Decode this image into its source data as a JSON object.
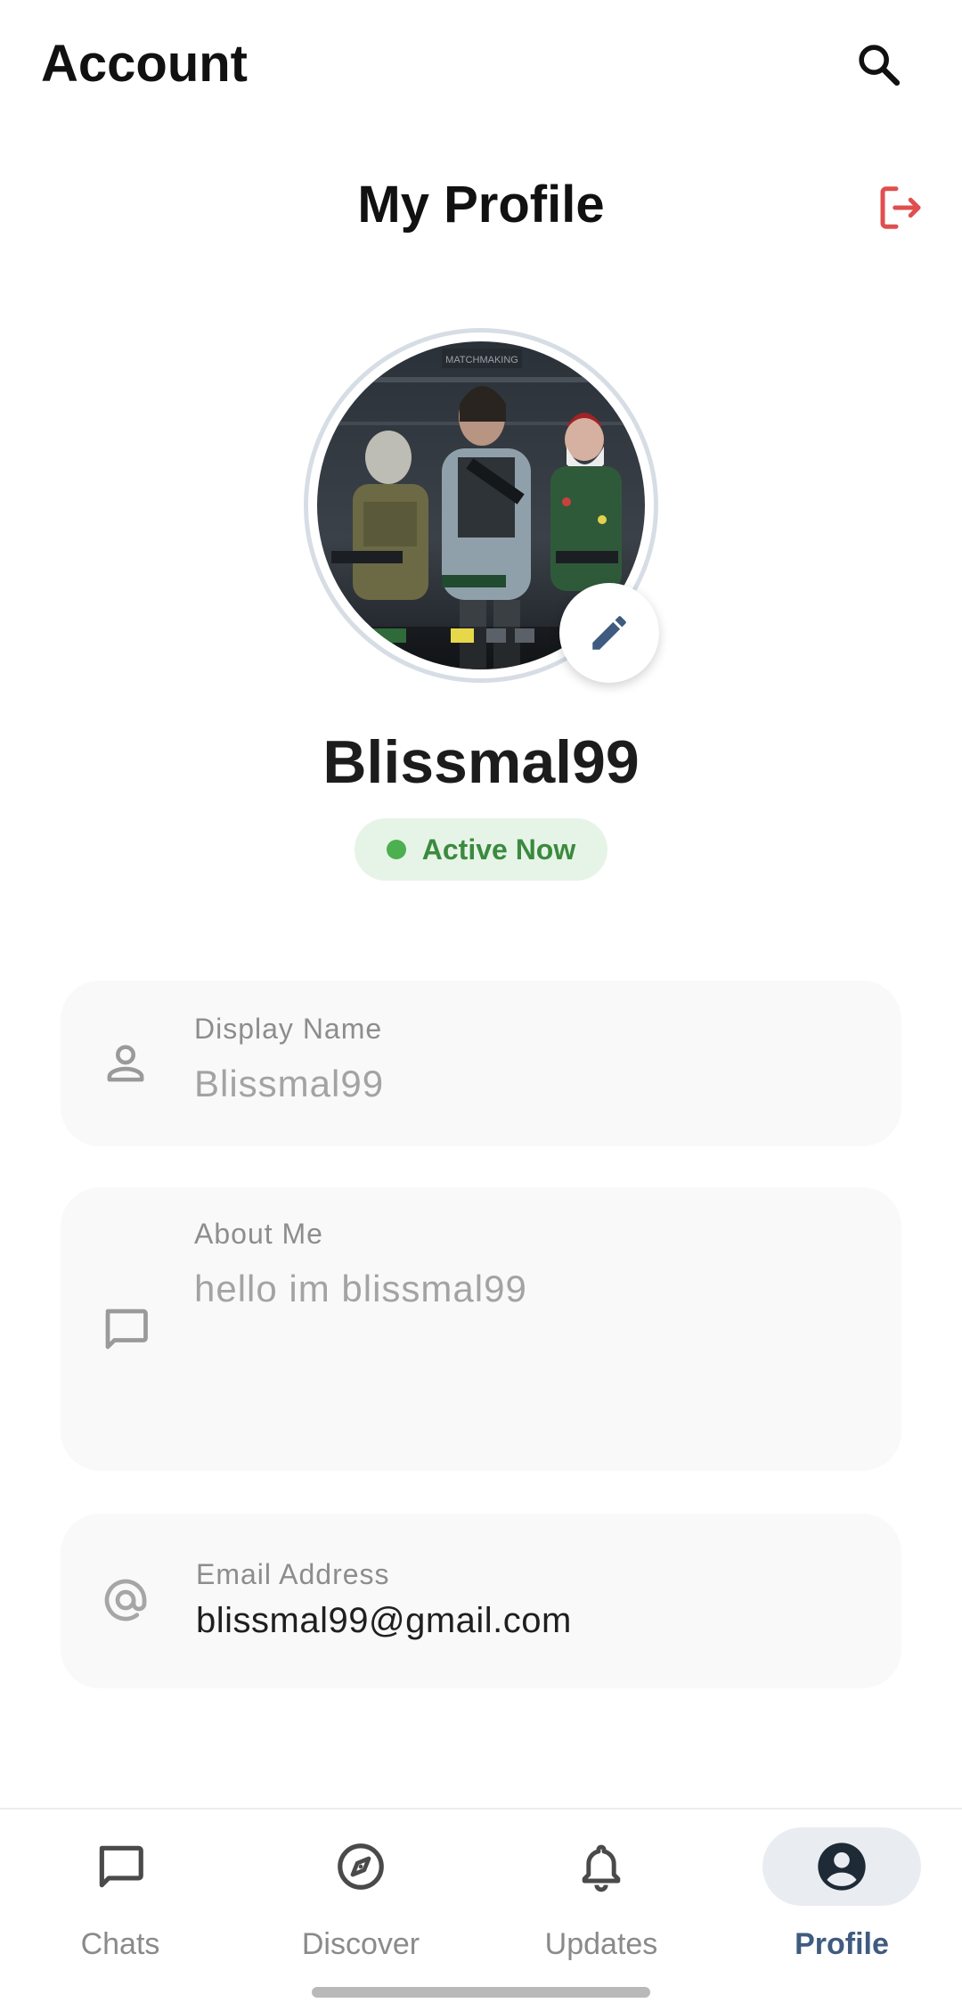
{
  "appbar": {
    "title": "Account"
  },
  "profile": {
    "section_title": "My Profile",
    "username": "Blissmal99",
    "status": "Active Now",
    "avatar_overlay_text": "MATCHMAKING"
  },
  "fields": [
    {
      "label": "Display Name",
      "value": "Blissmal99"
    },
    {
      "label": "About Me",
      "value": "hello im blissmal99"
    },
    {
      "label": "Email Address",
      "value": "blissmal99@gmail.com"
    }
  ],
  "nav": {
    "items": [
      {
        "label": "Chats",
        "icon": "chat-bubble-icon"
      },
      {
        "label": "Discover",
        "icon": "compass-icon"
      },
      {
        "label": "Updates",
        "icon": "bell-icon"
      },
      {
        "label": "Profile",
        "icon": "account-circle-icon"
      }
    ],
    "active": "Profile"
  },
  "colors": {
    "accent": "#3f5b7f",
    "logout": "#e04f4f",
    "status_bg": "#e6f4e7",
    "status_text": "#3b8a3f",
    "status_dot": "#4caf50",
    "card_bg": "#f9f9f9"
  }
}
